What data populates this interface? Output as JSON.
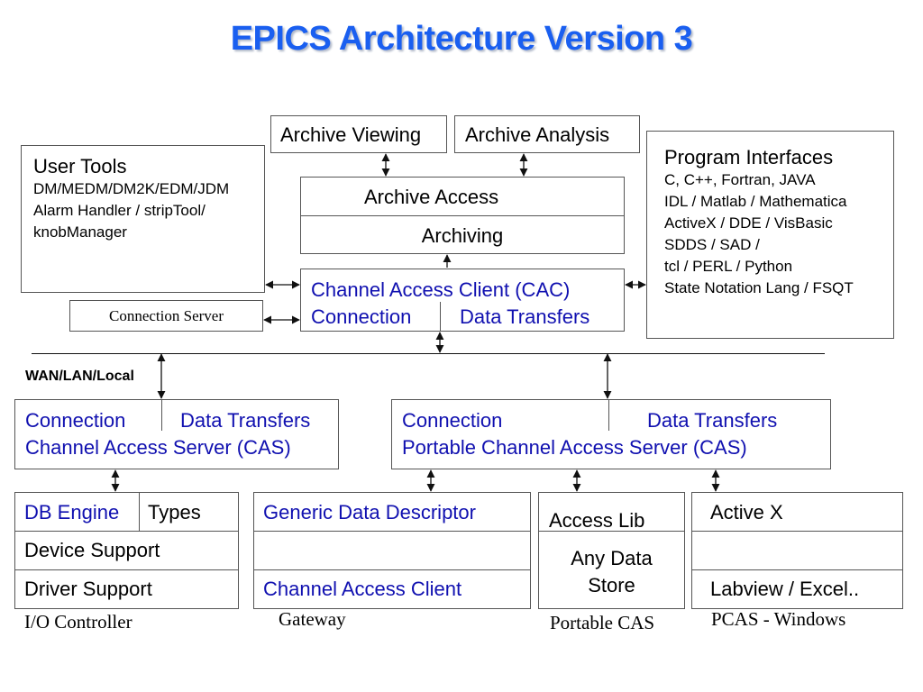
{
  "title": "EPICS Architecture Version 3",
  "archive": {
    "viewing": "Archive Viewing",
    "analysis": "Archive Analysis",
    "access": "Archive Access",
    "archiving": "Archiving"
  },
  "user_tools": {
    "heading": "User Tools",
    "lines": [
      "DM/MEDM/DM2K/EDM/JDM",
      "Alarm Handler / stripTool/",
      "knobManager"
    ]
  },
  "connection_server": "Connection Server",
  "cac": {
    "title": "Channel Access Client (CAC)",
    "connection": "Connection",
    "data_transfers": "Data Transfers"
  },
  "program_interfaces": {
    "heading": "Program Interfaces",
    "lines": [
      "C, C++, Fortran, JAVA",
      "IDL / Matlab / Mathematica",
      "ActiveX / DDE / VisBasic",
      "SDDS / SAD /",
      "tcl / PERL / Python",
      "State Notation Lang / FSQT"
    ]
  },
  "network_label": "WAN/LAN/Local",
  "cas": {
    "connection": "Connection",
    "data_transfers": "Data Transfers",
    "title": "Channel Access Server (CAS)"
  },
  "pcas": {
    "connection": "Connection",
    "data_transfers": "Data Transfers",
    "title": "Portable Channel Access Server (CAS)"
  },
  "ioc": {
    "db_engine": "DB Engine",
    "types": "Types",
    "device_support": "Device Support",
    "driver_support": "Driver Support",
    "caption": "I/O Controller"
  },
  "gateway": {
    "gdd": "Generic Data Descriptor",
    "middle": "",
    "cac": "Channel Access Client",
    "caption": "Gateway"
  },
  "portable_cas": {
    "access_lib": "Access Lib",
    "store_line1": "Any Data",
    "store_line2": "Store",
    "caption": "Portable CAS"
  },
  "pcas_windows": {
    "activex": "Active X",
    "middle": "",
    "labview": "Labview / Excel..",
    "caption": "PCAS - Windows"
  },
  "colors": {
    "title": "#1a5ff0",
    "blue_text": "#1010b0",
    "border": "#555555"
  }
}
